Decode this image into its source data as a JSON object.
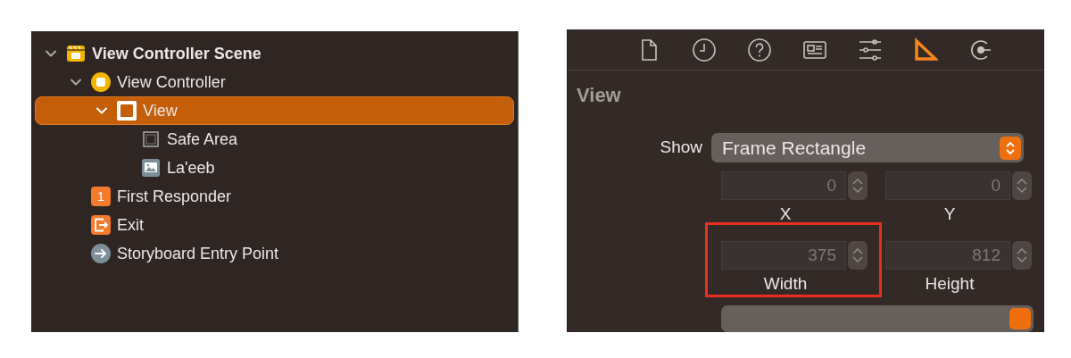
{
  "outline": [
    {
      "label": "View Controller Scene",
      "kind": "scene",
      "expanded": true,
      "selected": false,
      "children": [
        {
          "label": "View Controller",
          "kind": "controller",
          "expanded": true,
          "selected": false,
          "children": [
            {
              "label": "View",
              "kind": "view",
              "expanded": true,
              "selected": true,
              "children": [
                {
                  "label": "Safe Area",
                  "kind": "safe-area",
                  "selected": false
                },
                {
                  "label": "La'eeb",
                  "kind": "image",
                  "selected": false
                }
              ]
            }
          ]
        },
        {
          "label": "First Responder",
          "kind": "responder",
          "badge": "1",
          "selected": false
        },
        {
          "label": "Exit",
          "kind": "exit",
          "selected": false
        },
        {
          "label": "Storyboard Entry Point",
          "kind": "entry",
          "selected": false
        }
      ]
    }
  ],
  "inspector": {
    "tabs": [
      {
        "kind": "file",
        "selected": false
      },
      {
        "kind": "history",
        "selected": false
      },
      {
        "kind": "help",
        "selected": false
      },
      {
        "kind": "identity",
        "selected": false
      },
      {
        "kind": "attributes",
        "selected": false
      },
      {
        "kind": "size",
        "selected": true
      },
      {
        "kind": "connections",
        "selected": false
      }
    ],
    "section_title": "View",
    "show": {
      "label": "Show",
      "value": "Frame Rectangle"
    },
    "fields": [
      {
        "value": "0",
        "label": "X",
        "disabled": true,
        "highlighted": false
      },
      {
        "value": "0",
        "label": "Y",
        "disabled": true,
        "highlighted": false
      },
      {
        "value": "375",
        "label": "Width",
        "disabled": true,
        "highlighted": true
      },
      {
        "value": "812",
        "label": "Height",
        "disabled": true,
        "highlighted": false
      }
    ]
  }
}
